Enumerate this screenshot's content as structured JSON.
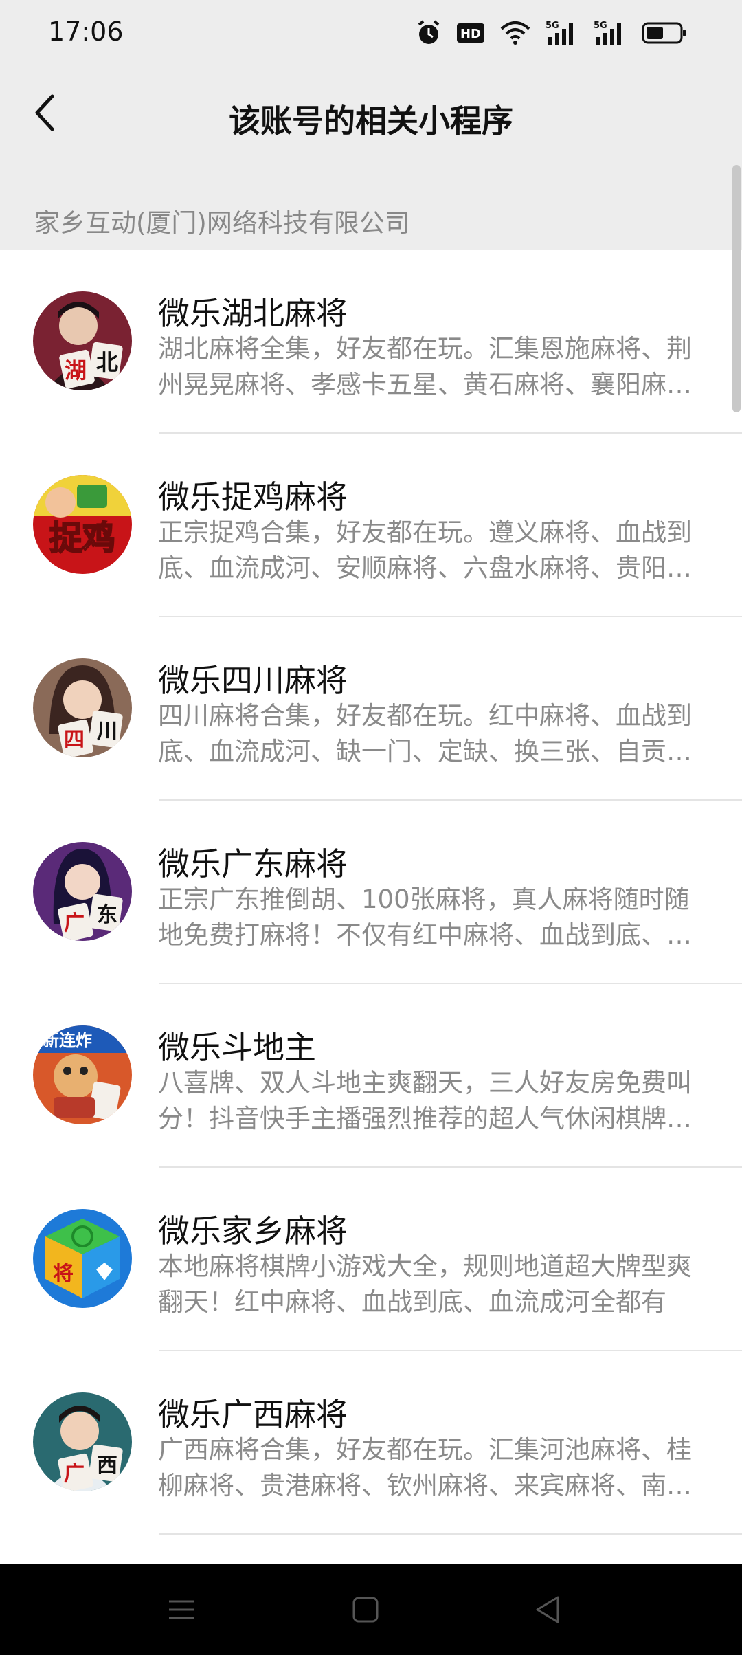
{
  "status_bar": {
    "time": "17:06",
    "icons": [
      "alarm-icon",
      "hd-icon",
      "wifi-icon",
      "signal-5g-icon",
      "signal-5g-icon",
      "battery-icon"
    ]
  },
  "header": {
    "title": "该账号的相关小程序",
    "back_icon": "back-chevron-icon"
  },
  "section": {
    "title": "家乡互动(厦门)网络科技有限公司"
  },
  "items": [
    {
      "name": "微乐湖北麻将",
      "desc": "湖北麻将全集，好友都在玩。汇集恩施麻将、荆州晃晃麻将、孝感卡五星、黄石麻将、襄阳麻将、十堰麻将",
      "avatar_tiles": [
        "湖",
        "北"
      ],
      "colors": [
        "#3a1420",
        "#7a2232"
      ]
    },
    {
      "name": "微乐捉鸡麻将",
      "desc": "正宗捉鸡合集，好友都在玩。遵义麻将、血战到底、血流成河、安顺麻将、六盘水麻将、贵阳捉鸡",
      "avatar_text": "捉鸡",
      "colors": [
        "#c81418",
        "#f0d23a"
      ]
    },
    {
      "name": "微乐四川麻将",
      "desc": "四川麻将合集，好友都在玩。红中麻将、血战到底、血流成河、缺一门、定缺、换三张、自贡麻将",
      "avatar_tiles": [
        "四",
        "川"
      ],
      "colors": [
        "#3b2520",
        "#8a6a58"
      ]
    },
    {
      "name": "微乐广东麻将",
      "desc": "正宗广东推倒胡、100张麻将，真人麻将随时随地免费打麻将！不仅有红中麻将、血战到底、鸡平胡",
      "avatar_tiles": [
        "广",
        "东"
      ],
      "colors": [
        "#1a1238",
        "#5a2a78"
      ]
    },
    {
      "name": "微乐斗地主",
      "desc": "八喜牌、双人斗地主爽翻天，三人好友房免费叫分！抖音快手主播强烈推荐的超人气休闲棋牌游戏",
      "avatar_text": "新连炸",
      "colors": [
        "#d8582a",
        "#f6b84a"
      ]
    },
    {
      "name": "微乐家乡麻将",
      "desc": "本地麻将棋牌小游戏大全，规则地道超大牌型爽翻天！红中麻将、血战到底、血流成河全都有",
      "avatar_text": "将",
      "colors": [
        "#1e7ad8",
        "#3ec04a"
      ]
    },
    {
      "name": "微乐广西麻将",
      "desc": "广西麻将合集，好友都在玩。汇集河池麻将、桂柳麻将、贵港麻将、钦州麻将、来宾麻将、南宁麻将",
      "avatar_tiles": [
        "广",
        "西"
      ],
      "colors": [
        "#123038",
        "#2a6a70"
      ]
    }
  ],
  "nav": {
    "buttons": [
      "menu-icon",
      "home-icon",
      "back-triangle-icon"
    ]
  }
}
